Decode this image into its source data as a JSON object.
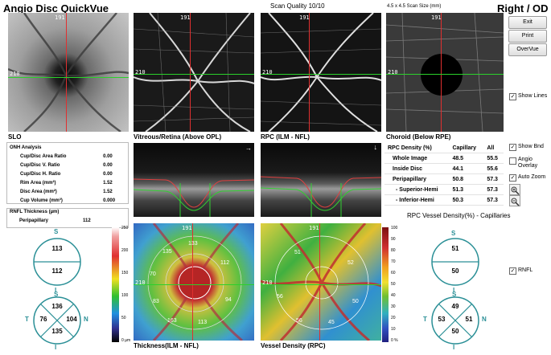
{
  "header": {
    "app_title": "Angio Disc QuickVue",
    "scan_quality": "Scan Quality 10/10",
    "scan_size": "4.5 x 4.5 Scan Size (mm)",
    "eye": "Right / OD"
  },
  "buttons": {
    "exit": "Exit",
    "print": "Print",
    "overvue": "OverVue"
  },
  "options": {
    "show_lines": "Show Lines",
    "show_bnd": "Show Bnd",
    "angio_overlay_1": "Angio",
    "angio_overlay_2": "Overlay",
    "auto_zoom": "Auto Zoom",
    "rnfl": "RNFL",
    "check_mark": "✓"
  },
  "images": {
    "slo": "SLO",
    "vitreous": "Vitreous/Retina (Above OPL)",
    "rpc": "RPC (ILM - NFL)",
    "choroid": "Choroid (Below RPE)",
    "thickness": "Thickness(ILM - NFL)",
    "vessel_density": "Vessel Density (RPC)",
    "scan_h": "191",
    "scan_v": "210"
  },
  "onh": {
    "header": "ONH Analysis",
    "rows": [
      {
        "label": "Cup/Disc Area Ratio",
        "value": "0.00"
      },
      {
        "label": "Cup/Disc V. Ratio",
        "value": "0.00"
      },
      {
        "label": "Cup/Disc H. Ratio",
        "value": "0.00"
      },
      {
        "label": "Rim Area (mm²)",
        "value": "1.52"
      },
      {
        "label": "Disc Area (mm²)",
        "value": "1.52"
      },
      {
        "label": "Cup Volume (mm³)",
        "value": "0.000"
      }
    ]
  },
  "rnfl": {
    "header": "RNFL Thickness (µm)",
    "label": "Peripapillary",
    "value": "112"
  },
  "rpc_table": {
    "headers": [
      "RPC Density (%)",
      "Capillary",
      "All"
    ],
    "rows": [
      [
        "Whole Image",
        "48.5",
        "55.5"
      ],
      [
        "Inside Disc",
        "44.1",
        "55.6"
      ],
      [
        "Peripapillary",
        "50.8",
        "57.3"
      ],
      [
        "- Superior-Hemi",
        "51.3",
        "57.3"
      ],
      [
        "- Inferior-Hemi",
        "50.3",
        "57.3"
      ]
    ]
  },
  "rpc_vessel_title": "RPC Vessel Density(%) - Capillaries",
  "thickness_scale": {
    "ticks": [
      "250",
      "200",
      "150",
      "100",
      "50",
      "0 µm"
    ]
  },
  "density_scale": {
    "ticks": [
      "100",
      "90",
      "80",
      "70",
      "60",
      "50",
      "40",
      "30",
      "20",
      "10",
      "0 %"
    ]
  },
  "thickness_map_labels": [
    "133",
    "135",
    "112",
    "70",
    "83",
    "94",
    "163",
    "113"
  ],
  "density_map_labels": [
    "51",
    "52",
    "56",
    "50",
    "56",
    "45"
  ],
  "left_diagrams": {
    "hemi_top": "113",
    "hemi_bottom": "112",
    "q_top": "136",
    "q_left": "76",
    "q_right": "104",
    "q_bottom": "135",
    "s": "S",
    "i": "I",
    "t": "T",
    "n": "N"
  },
  "right_diagrams": {
    "hemi_top": "51",
    "hemi_bottom": "50",
    "q_top": "49",
    "q_left": "53",
    "q_right": "51",
    "q_bottom": "50",
    "s": "S",
    "i": "I",
    "t": "T",
    "n": "N"
  }
}
